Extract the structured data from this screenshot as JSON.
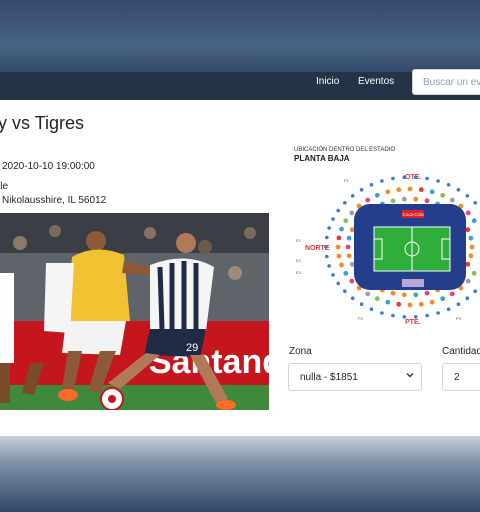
{
  "nav": {
    "links": [
      "Inicio",
      "Eventos"
    ],
    "search_placeholder": "Buscar un eve"
  },
  "event": {
    "title": "ey vs Tigres",
    "datetime": "2020-10-10 19:00:00",
    "venue": "lle",
    "address": "Nikolausshire, IL 56012"
  },
  "photo": {
    "banner_text": "Santander",
    "player_number": "29"
  },
  "stadium": {
    "title_line1": "UBICACIÓN DENTRO DEL ESTADIO",
    "title_line2": "PLANTA BAJA",
    "north": "NORTE",
    "east": "OTE.",
    "west": "PTE.",
    "sponsor": "Coca-Cola",
    "zone_codes": [
      "E1",
      "E2",
      "E3",
      "E4",
      "E5",
      "E6",
      "E7",
      "E8",
      "P1",
      "P2",
      "P3",
      "P4"
    ]
  },
  "form": {
    "zona_label": "Zona",
    "zona_value": "nulla - $1851",
    "cantidad_label": "Cantidad",
    "cantidad_value": "2"
  },
  "colors": {
    "navbar": "#243447",
    "pitch": "#2fae3c",
    "stadium_ring": "#233e8b"
  }
}
